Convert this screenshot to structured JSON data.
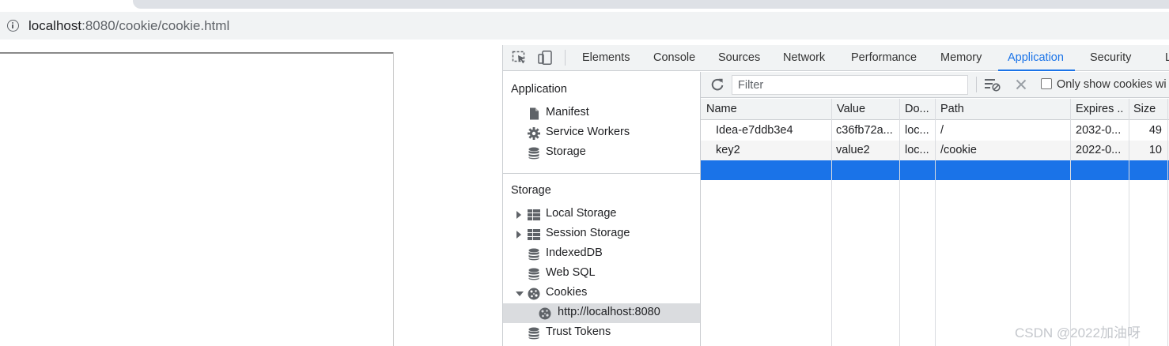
{
  "browser": {
    "url_host": "localhost",
    "url_path": ":8080/cookie/cookie.html"
  },
  "devtools": {
    "tabs": [
      "Elements",
      "Console",
      "Sources",
      "Network",
      "Performance",
      "Memory",
      "Application",
      "Security",
      "L"
    ],
    "active_tab": "Application",
    "sidebar": {
      "application_heading": "Application",
      "application_items": [
        "Manifest",
        "Service Workers",
        "Storage"
      ],
      "storage_heading": "Storage",
      "storage_items": [
        "Local Storage",
        "Session Storage",
        "IndexedDB",
        "Web SQL",
        "Cookies"
      ],
      "cookie_origin": "http://localhost:8080",
      "trust_tokens": "Trust Tokens"
    },
    "filter": {
      "placeholder": "Filter",
      "only_show_label": "Only show cookies wi",
      "only_show_checked": false
    },
    "table": {
      "headers": [
        "Name",
        "Value",
        "Do...",
        "Path",
        "Expires ..",
        "Size"
      ],
      "rows": [
        [
          "Idea-e7ddb3e4",
          "c36fb72a...",
          "loc...",
          "/",
          "2032-0...",
          "49"
        ],
        [
          "key2",
          "value2",
          "loc...",
          "/cookie",
          "2022-0...",
          "10"
        ]
      ],
      "selected_row_color": "#1a73e8"
    },
    "accent_color": "#1a73e8"
  },
  "watermark": "CSDN @2022加油呀"
}
